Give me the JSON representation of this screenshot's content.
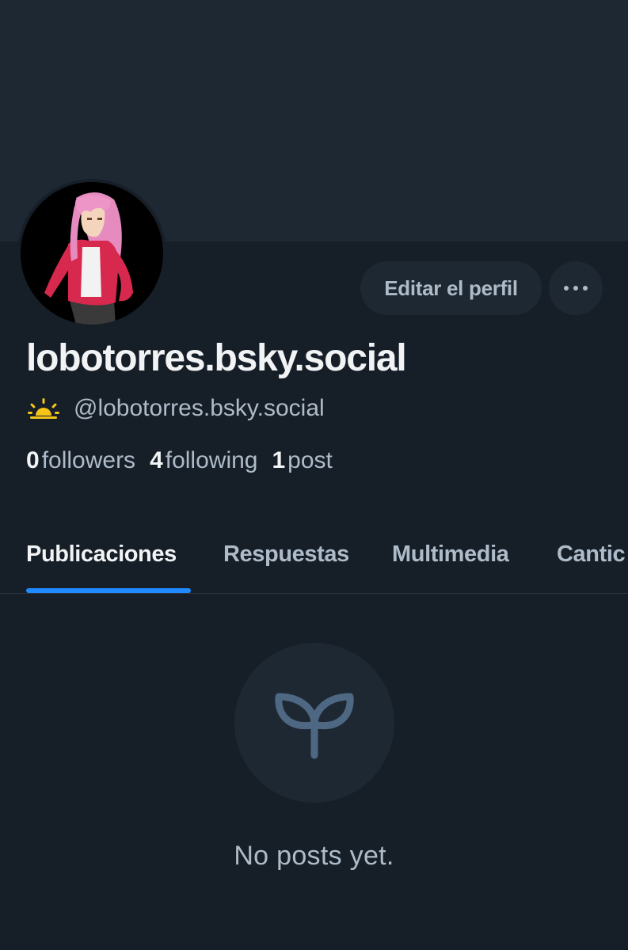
{
  "profile": {
    "display_name": "lobotorres.bsky.social",
    "handle": "@lobotorres.bsky.social",
    "status_icon": "sunrise-icon"
  },
  "actions": {
    "edit_label": "Editar el perfil",
    "more_icon": "ellipsis-icon"
  },
  "stats": {
    "followers_count": "0",
    "followers_label": "followers",
    "following_count": "4",
    "following_label": "following",
    "posts_count": "1",
    "posts_label": "post"
  },
  "tabs": [
    {
      "label": "Publicaciones",
      "active": true
    },
    {
      "label": "Respuestas",
      "active": false
    },
    {
      "label": "Multimedia",
      "active": false
    },
    {
      "label": "Cantic",
      "active": false
    }
  ],
  "empty_state": {
    "icon": "seedling-icon",
    "message": "No posts yet."
  },
  "colors": {
    "background": "#161e27",
    "banner": "#1e2833",
    "accent": "#208bfe",
    "muted_text": "#aebbc9",
    "primary_text": "#f1f3f5"
  }
}
